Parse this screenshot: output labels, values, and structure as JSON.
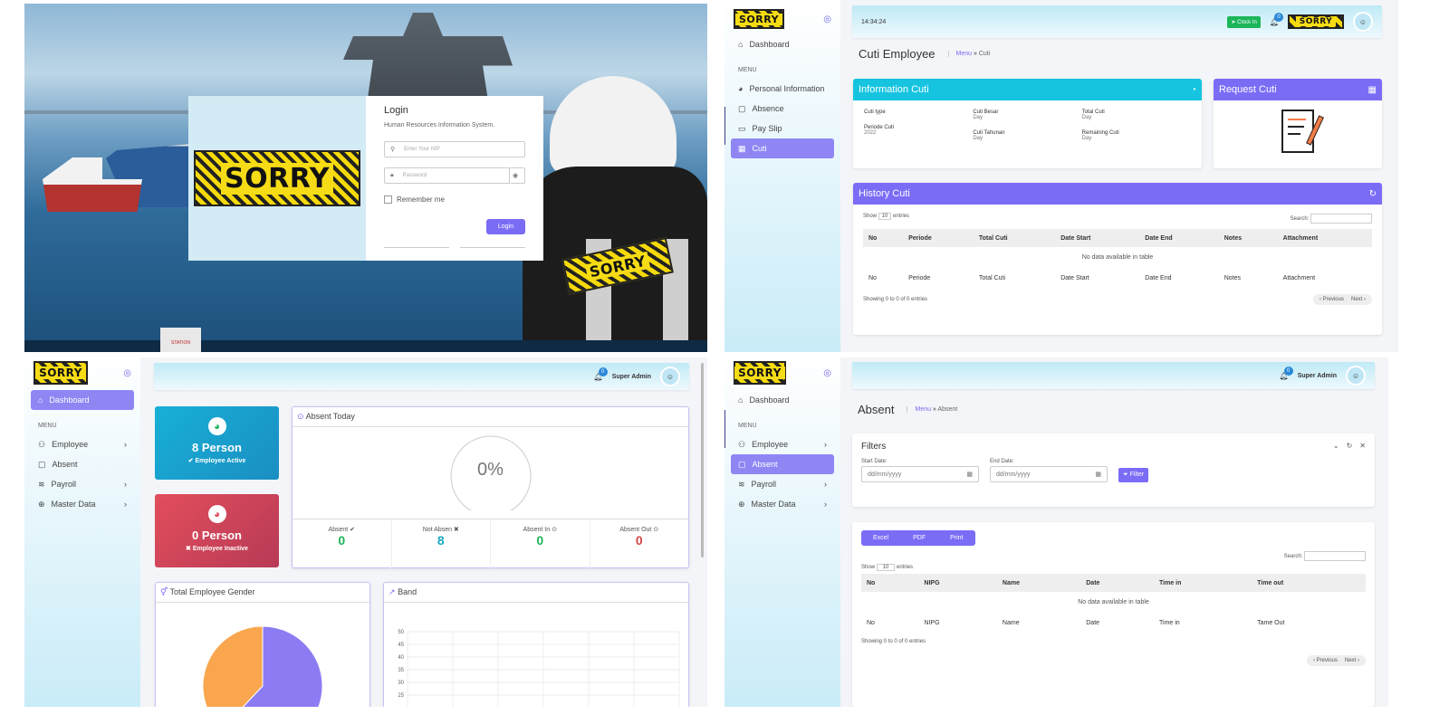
{
  "logo_text": "SORRY",
  "login": {
    "title": "Login",
    "subtitle": "Human Resources Information System.",
    "nip_placeholder": "Enter Your NIP",
    "password_placeholder": "Password",
    "remember": "Remember me",
    "button": "Login",
    "sign_text": "SORRY",
    "station_text": "STATION"
  },
  "cuti": {
    "time": "14:34:24",
    "clock_in": "Clock In",
    "notif_count": "0",
    "sidebar": {
      "dashboard": "Dashboard",
      "menu": "MENU",
      "items": [
        "Personal Information",
        "Absence",
        "Pay Slip",
        "Cuti"
      ]
    },
    "page_title": "Cuti Employee",
    "breadcrumb": [
      "Menu",
      "Cuti"
    ],
    "info_title": "Information Cuti",
    "request_title": "Request Cuti",
    "info": {
      "cuti_type": "Cuti type",
      "periode_label": "Periode Cuti",
      "periode_value": "2022",
      "cuti_besar": "Cuti Besar",
      "cuti_besar_val": "Day",
      "cuti_tahunan": "Cuti Tahunan",
      "cuti_tahunan_val": "Day",
      "total": "Total Cuti",
      "total_val": "Day",
      "remaining": "Remaining Cuti",
      "remaining_val": "Day"
    },
    "history_title": "History Cuti",
    "show": "Show",
    "show_val": "10",
    "entries": "entries",
    "search": "Search:",
    "columns": [
      "No",
      "Periode",
      "Total Cuti",
      "Date Start",
      "Date End",
      "Notes",
      "Attachment"
    ],
    "empty": "No data available in table",
    "showing": "Showing 0 to 0 of 0 entries",
    "prev": "‹ Previous",
    "next": "Next ›"
  },
  "dashboard": {
    "sidebar": {
      "dashboard": "Dashboard",
      "menu": "MENU",
      "items": [
        "Employee",
        "Absent",
        "Payroll",
        "Master Data"
      ]
    },
    "notif_count": "0",
    "user": "Super Admin",
    "active_count": "8 Person",
    "active_label": "✔ Employee Active",
    "inactive_count": "0 Person",
    "inactive_label": "✖ Employee Inactive",
    "absent_today": "Absent Today",
    "gauge": "0%",
    "stats": [
      {
        "label": "Absent ✔",
        "value": "0",
        "color": "#1bb55a"
      },
      {
        "label": "Not Absen ✖",
        "value": "8",
        "color": "#17a8c4"
      },
      {
        "label": "Absent In ⊙",
        "value": "0",
        "color": "#1bb55a"
      },
      {
        "label": "Absent Out ⊙",
        "value": "0",
        "color": "#d64545"
      }
    ],
    "gender_title": "Total Employee Gender",
    "band_title": "Band"
  },
  "chart_data": [
    {
      "type": "pie",
      "title": "Total Employee Gender",
      "values": [
        62,
        38
      ],
      "colors": [
        "#8c7cf3",
        "#f9a64e"
      ]
    },
    {
      "type": "line",
      "title": "Band",
      "yticks": [
        "50",
        "45",
        "40",
        "35",
        "30",
        "25"
      ],
      "ylim": [
        25,
        50
      ]
    }
  ],
  "absent": {
    "sidebar": {
      "dashboard": "Dashboard",
      "menu": "MENU",
      "items": [
        "Employee",
        "Absent",
        "Payroll",
        "Master Data"
      ]
    },
    "notif_count": "0",
    "user": "Super Admin",
    "page_title": "Absent",
    "breadcrumb": [
      "Menu",
      "Absent"
    ],
    "filters": "Filters",
    "start_label": "Start Date:",
    "end_label": "End Date:",
    "date_placeholder": "dd/mm/yyyy",
    "filter_btn": "Filter",
    "export": [
      "Excel",
      "PDF",
      "Print"
    ],
    "search": "Search:",
    "show": "Show",
    "show_val": "10",
    "entries": "entries",
    "columns": [
      "No",
      "NIPG",
      "Name",
      "Date",
      "Time in",
      "Time out"
    ],
    "foot_columns": [
      "No",
      "NIPG",
      "Name",
      "Date",
      "Time in",
      "Tame Out"
    ],
    "empty": "No data available in table",
    "showing": "Showing 0 to 0 of 0 entries",
    "prev": "‹ Previous",
    "next": "Next ›"
  }
}
